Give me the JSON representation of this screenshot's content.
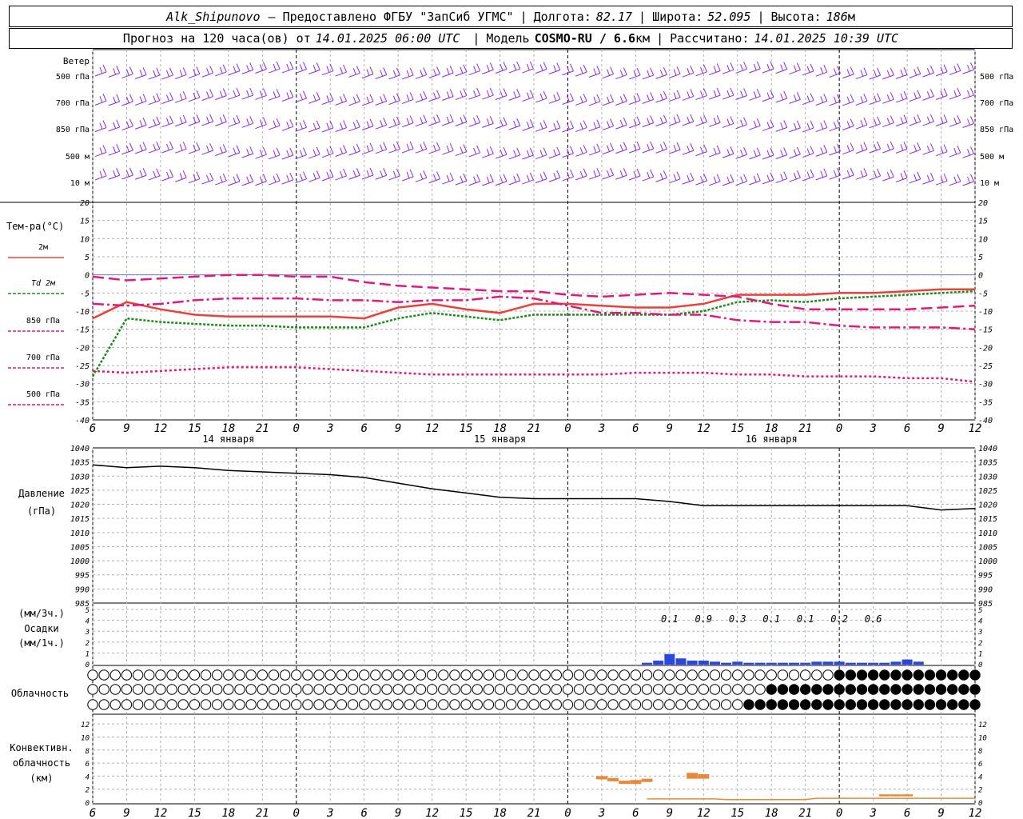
{
  "header": {
    "station": "Alk_Shipunovo",
    "provider": "– Предоставлено ФГБУ \"ЗапСиб УГМС\"",
    "lon_label": "Долгота:",
    "lon": "82.17",
    "lat_label": "Широта:",
    "lat": "52.095",
    "alt_label": "Высота:",
    "alt": "186",
    "alt_unit": "м",
    "forecast_prefix": "Прогноз на 120 часа(ов) от",
    "forecast_start": "14.01.2025 06:00 UTC",
    "model_label": "Модель",
    "model": "COSMO-RU / 6.6",
    "model_unit": "км",
    "computed_label": "Рассчитано:",
    "computed": "14.01.2025 10:39 UTC"
  },
  "colors": {
    "t2m": "#e8423a",
    "td2m": "#1a8a1a",
    "t850": "#e01a7a",
    "t700": "#e01a7a",
    "t500": "#e01a7a",
    "zero_line": "#6a7ad8",
    "wind": "#8a2be2",
    "precip": "#2a48e0",
    "convective": "#e8893a",
    "pressure": "#000000",
    "grid": "#b0b0b0"
  },
  "chart_data": [
    {
      "type": "wind_barbs",
      "title": "Ветер",
      "levels": [
        "500 гПа",
        "700 гПа",
        "850 гПа",
        "500 м",
        "10 м"
      ]
    },
    {
      "type": "line",
      "ylabel": "Тем-ра(°C)",
      "ylim": [
        -40,
        20
      ],
      "yticks": [
        20,
        15,
        10,
        5,
        0,
        -5,
        -10,
        -15,
        -20,
        -25,
        -30,
        -35,
        -40
      ],
      "x_hours": [
        0,
        3,
        6,
        9,
        12,
        15,
        18,
        21,
        24,
        27,
        30,
        33,
        36,
        39,
        42,
        45,
        48,
        51,
        54,
        57,
        60,
        63,
        66,
        69,
        72,
        75,
        78
      ],
      "legend": [
        "2м",
        "Td 2м",
        "850 гПа",
        "700 гПа",
        "500 гПа"
      ],
      "series": [
        {
          "name": "2м",
          "values": [
            -12,
            -7.5,
            -9.5,
            -11,
            -11.5,
            -11.5,
            -11.5,
            -11.5,
            -12,
            -9,
            -8,
            -9.5,
            -10.5,
            -8,
            -8,
            -8.5,
            -9,
            -9,
            -8,
            -5.5,
            -5.5,
            -5.5,
            -5,
            -5,
            -4.5,
            -4,
            -4
          ]
        },
        {
          "name": "Td 2м",
          "values": [
            -28,
            -12,
            -13,
            -13.5,
            -14,
            -14,
            -14.5,
            -14.5,
            -14.5,
            -12,
            -10.5,
            -11.5,
            -12.5,
            -11,
            -11,
            -11,
            -11,
            -11,
            -10,
            -7.5,
            -7,
            -7.5,
            -6.5,
            -6,
            -5.5,
            -5,
            -4.5
          ]
        },
        {
          "name": "850 гПа",
          "values": [
            -0.5,
            -1.5,
            -1,
            -0.5,
            0,
            0,
            -0.5,
            -0.5,
            -2,
            -3,
            -3.5,
            -4,
            -4.5,
            -4.5,
            -5.5,
            -6,
            -5.5,
            -5,
            -5.5,
            -6,
            -8,
            -9.5,
            -9.5,
            -9.5,
            -9.5,
            -9,
            -8.5
          ]
        },
        {
          "name": "700 гПа",
          "values": [
            -8,
            -8.5,
            -8,
            -7,
            -6.5,
            -6.5,
            -6.5,
            -7,
            -7,
            -7.5,
            -7,
            -7,
            -6,
            -6.5,
            -8.5,
            -10.5,
            -10.5,
            -11,
            -11,
            -12.5,
            -13,
            -13,
            -14,
            -14.5,
            -14.5,
            -14.5,
            -15
          ]
        },
        {
          "name": "500 гПа",
          "values": [
            -26.5,
            -27,
            -26.5,
            -26,
            -25.5,
            -25.5,
            -25.5,
            -26,
            -26.5,
            -27,
            -27.5,
            -27.5,
            -27.5,
            -27.5,
            -27.5,
            -27.5,
            -27,
            -27,
            -27,
            -27.5,
            -27.5,
            -28,
            -28,
            -28,
            -28.5,
            -28.5,
            -29.5
          ]
        }
      ]
    },
    {
      "type": "line",
      "ylabel": "Давление",
      "yunit": "(гПа)",
      "ylim": [
        985,
        1040
      ],
      "yticks": [
        1040,
        1035,
        1030,
        1025,
        1020,
        1015,
        1010,
        1005,
        1000,
        995,
        990,
        985
      ],
      "series": [
        {
          "name": "",
          "values": [
            1034,
            1033,
            1033.5,
            1033,
            1032,
            1031.5,
            1031,
            1030.5,
            1029.5,
            1027.5,
            1025.5,
            1024,
            1022.5,
            1022,
            1022,
            1022,
            1022,
            1021,
            1019.5,
            1019.5,
            1019.5,
            1019.5,
            1019.5,
            1019.5,
            1019.5,
            1018,
            1018.5
          ]
        }
      ]
    },
    {
      "type": "bar",
      "ylabel_top": "(мм/3ч.)",
      "ylabel": "Осадки",
      "ylabel_bottom": "(мм/1ч.)",
      "ylim": [
        0,
        5
      ],
      "yticks": [
        5,
        4,
        3,
        2,
        1,
        0
      ],
      "totals_3h": [
        "0.1",
        "0.9",
        "0.3",
        "0.1",
        "0.1",
        "0.2",
        "0.6"
      ],
      "hourly": [
        0.1,
        0.3,
        0.9,
        0.5,
        0.3,
        0.3,
        0.2,
        0.1,
        0.2,
        0.1,
        0.1,
        0.1,
        0.1,
        0.1,
        0.1,
        0.2,
        0.2,
        0.2,
        0.1,
        0.1,
        0.1,
        0.1,
        0.2,
        0.4,
        0.2
      ]
    },
    {
      "type": "cloud_symbols",
      "ylabel": "Облачность",
      "rows": 3
    },
    {
      "type": "bar",
      "ylabel": "Конвективн. облачность",
      "yunit": "(км)",
      "ylim": [
        0,
        13
      ],
      "yticks": [
        12,
        10,
        8,
        6,
        4,
        2,
        0
      ]
    }
  ],
  "x_axis": {
    "hour_labels": [
      "6",
      "9",
      "12",
      "15",
      "18",
      "21",
      "0",
      "3",
      "6",
      "9",
      "12",
      "15",
      "18",
      "21",
      "0",
      "3",
      "6",
      "9",
      "12",
      "15",
      "18",
      "21",
      "0",
      "3",
      "6",
      "9",
      "12"
    ],
    "day_labels": [
      "14 января",
      "15 января",
      "16 января"
    ]
  }
}
